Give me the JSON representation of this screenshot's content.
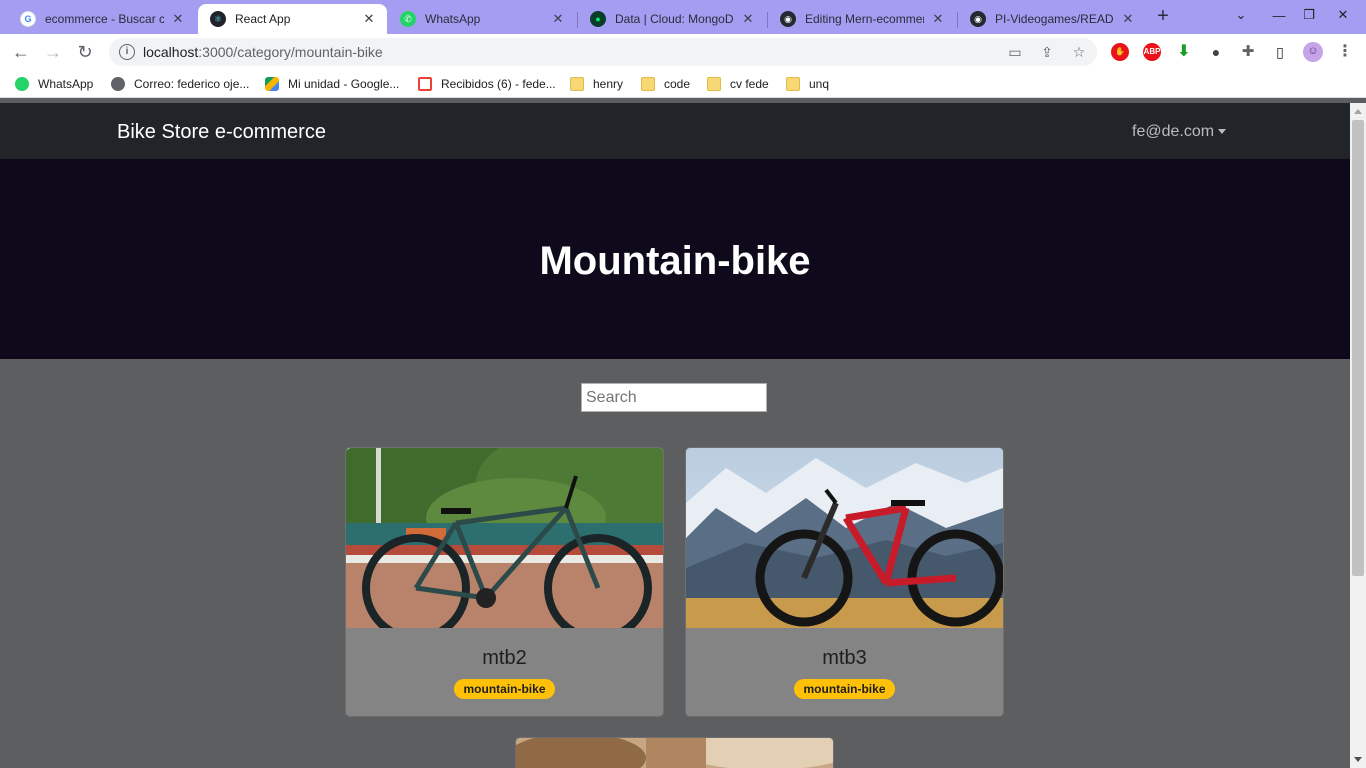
{
  "browser": {
    "tabs": [
      {
        "title": "ecommerce - Buscar co",
        "icon": "google-icon",
        "active": false
      },
      {
        "title": "React App",
        "icon": "react-icon",
        "active": true
      },
      {
        "title": "WhatsApp",
        "icon": "whatsapp-icon",
        "active": false
      },
      {
        "title": "Data | Cloud: MongoDB",
        "icon": "mongodb-icon",
        "active": false
      },
      {
        "title": "Editing Mern-ecommer",
        "icon": "github-icon",
        "active": false
      },
      {
        "title": "PI-Videogames/READM",
        "icon": "github-icon",
        "active": false
      }
    ],
    "url_host": "localhost",
    "url_path": ":3000/category/mountain-bike",
    "bookmarks": [
      {
        "label": "WhatsApp",
        "icon": "whatsapp-icon"
      },
      {
        "label": "Correo: federico oje...",
        "icon": "mail-globe-icon"
      },
      {
        "label": "Mi unidad - Google...",
        "icon": "google-drive-icon"
      },
      {
        "label": "Recibidos (6) - fede...",
        "icon": "gmail-icon"
      },
      {
        "label": "henry",
        "icon": "folder-icon"
      },
      {
        "label": "code",
        "icon": "folder-icon"
      },
      {
        "label": "cv fede",
        "icon": "folder-icon"
      },
      {
        "label": "unq",
        "icon": "folder-icon"
      }
    ],
    "theme_color": "#a59df2"
  },
  "navbar": {
    "brand": "Bike Store e-commerce",
    "user": "fe@de.com"
  },
  "hero": {
    "title": "Mountain-bike"
  },
  "search": {
    "placeholder": "Search"
  },
  "products": [
    {
      "name": "mtb2",
      "category": "mountain-bike"
    },
    {
      "name": "mtb3",
      "category": "mountain-bike"
    }
  ],
  "colors": {
    "badge": "#ffc107",
    "navbar": "#212529",
    "hero": "#0f0a1b",
    "page_bg": "#5d5e60"
  }
}
